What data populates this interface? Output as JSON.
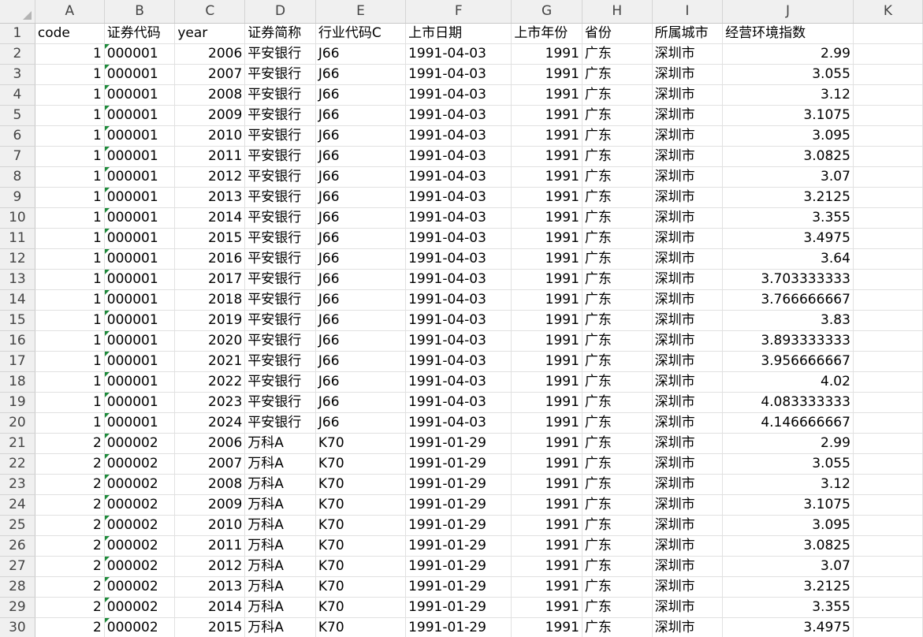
{
  "sheet": {
    "column_headers": [
      "A",
      "B",
      "C",
      "D",
      "E",
      "F",
      "G",
      "H",
      "I",
      "J",
      "K"
    ],
    "rows": [
      {
        "n": "1",
        "cells": [
          "code",
          "证券代码",
          "year",
          "证券简称",
          "行业代码C",
          "上市日期",
          "上市年份",
          "省份",
          "所属城市",
          "经营环境指数",
          ""
        ]
      },
      {
        "n": "2",
        "cells": [
          "1",
          "000001",
          "2006",
          "平安银行",
          "J66",
          "1991-04-03",
          "1991",
          "广东",
          "深圳市",
          "2.99",
          ""
        ]
      },
      {
        "n": "3",
        "cells": [
          "1",
          "000001",
          "2007",
          "平安银行",
          "J66",
          "1991-04-03",
          "1991",
          "广东",
          "深圳市",
          "3.055",
          ""
        ]
      },
      {
        "n": "4",
        "cells": [
          "1",
          "000001",
          "2008",
          "平安银行",
          "J66",
          "1991-04-03",
          "1991",
          "广东",
          "深圳市",
          "3.12",
          ""
        ]
      },
      {
        "n": "5",
        "cells": [
          "1",
          "000001",
          "2009",
          "平安银行",
          "J66",
          "1991-04-03",
          "1991",
          "广东",
          "深圳市",
          "3.1075",
          ""
        ]
      },
      {
        "n": "6",
        "cells": [
          "1",
          "000001",
          "2010",
          "平安银行",
          "J66",
          "1991-04-03",
          "1991",
          "广东",
          "深圳市",
          "3.095",
          ""
        ]
      },
      {
        "n": "7",
        "cells": [
          "1",
          "000001",
          "2011",
          "平安银行",
          "J66",
          "1991-04-03",
          "1991",
          "广东",
          "深圳市",
          "3.0825",
          ""
        ]
      },
      {
        "n": "8",
        "cells": [
          "1",
          "000001",
          "2012",
          "平安银行",
          "J66",
          "1991-04-03",
          "1991",
          "广东",
          "深圳市",
          "3.07",
          ""
        ]
      },
      {
        "n": "9",
        "cells": [
          "1",
          "000001",
          "2013",
          "平安银行",
          "J66",
          "1991-04-03",
          "1991",
          "广东",
          "深圳市",
          "3.2125",
          ""
        ]
      },
      {
        "n": "10",
        "cells": [
          "1",
          "000001",
          "2014",
          "平安银行",
          "J66",
          "1991-04-03",
          "1991",
          "广东",
          "深圳市",
          "3.355",
          ""
        ]
      },
      {
        "n": "11",
        "cells": [
          "1",
          "000001",
          "2015",
          "平安银行",
          "J66",
          "1991-04-03",
          "1991",
          "广东",
          "深圳市",
          "3.4975",
          ""
        ]
      },
      {
        "n": "12",
        "cells": [
          "1",
          "000001",
          "2016",
          "平安银行",
          "J66",
          "1991-04-03",
          "1991",
          "广东",
          "深圳市",
          "3.64",
          ""
        ]
      },
      {
        "n": "13",
        "cells": [
          "1",
          "000001",
          "2017",
          "平安银行",
          "J66",
          "1991-04-03",
          "1991",
          "广东",
          "深圳市",
          "3.703333333",
          ""
        ]
      },
      {
        "n": "14",
        "cells": [
          "1",
          "000001",
          "2018",
          "平安银行",
          "J66",
          "1991-04-03",
          "1991",
          "广东",
          "深圳市",
          "3.766666667",
          ""
        ]
      },
      {
        "n": "15",
        "cells": [
          "1",
          "000001",
          "2019",
          "平安银行",
          "J66",
          "1991-04-03",
          "1991",
          "广东",
          "深圳市",
          "3.83",
          ""
        ]
      },
      {
        "n": "16",
        "cells": [
          "1",
          "000001",
          "2020",
          "平安银行",
          "J66",
          "1991-04-03",
          "1991",
          "广东",
          "深圳市",
          "3.893333333",
          ""
        ]
      },
      {
        "n": "17",
        "cells": [
          "1",
          "000001",
          "2021",
          "平安银行",
          "J66",
          "1991-04-03",
          "1991",
          "广东",
          "深圳市",
          "3.956666667",
          ""
        ]
      },
      {
        "n": "18",
        "cells": [
          "1",
          "000001",
          "2022",
          "平安银行",
          "J66",
          "1991-04-03",
          "1991",
          "广东",
          "深圳市",
          "4.02",
          ""
        ]
      },
      {
        "n": "19",
        "cells": [
          "1",
          "000001",
          "2023",
          "平安银行",
          "J66",
          "1991-04-03",
          "1991",
          "广东",
          "深圳市",
          "4.083333333",
          ""
        ]
      },
      {
        "n": "20",
        "cells": [
          "1",
          "000001",
          "2024",
          "平安银行",
          "J66",
          "1991-04-03",
          "1991",
          "广东",
          "深圳市",
          "4.146666667",
          ""
        ]
      },
      {
        "n": "21",
        "cells": [
          "2",
          "000002",
          "2006",
          "万科A",
          "K70",
          "1991-01-29",
          "1991",
          "广东",
          "深圳市",
          "2.99",
          ""
        ]
      },
      {
        "n": "22",
        "cells": [
          "2",
          "000002",
          "2007",
          "万科A",
          "K70",
          "1991-01-29",
          "1991",
          "广东",
          "深圳市",
          "3.055",
          ""
        ]
      },
      {
        "n": "23",
        "cells": [
          "2",
          "000002",
          "2008",
          "万科A",
          "K70",
          "1991-01-29",
          "1991",
          "广东",
          "深圳市",
          "3.12",
          ""
        ]
      },
      {
        "n": "24",
        "cells": [
          "2",
          "000002",
          "2009",
          "万科A",
          "K70",
          "1991-01-29",
          "1991",
          "广东",
          "深圳市",
          "3.1075",
          ""
        ]
      },
      {
        "n": "25",
        "cells": [
          "2",
          "000002",
          "2010",
          "万科A",
          "K70",
          "1991-01-29",
          "1991",
          "广东",
          "深圳市",
          "3.095",
          ""
        ]
      },
      {
        "n": "26",
        "cells": [
          "2",
          "000002",
          "2011",
          "万科A",
          "K70",
          "1991-01-29",
          "1991",
          "广东",
          "深圳市",
          "3.0825",
          ""
        ]
      },
      {
        "n": "27",
        "cells": [
          "2",
          "000002",
          "2012",
          "万科A",
          "K70",
          "1991-01-29",
          "1991",
          "广东",
          "深圳市",
          "3.07",
          ""
        ]
      },
      {
        "n": "28",
        "cells": [
          "2",
          "000002",
          "2013",
          "万科A",
          "K70",
          "1991-01-29",
          "1991",
          "广东",
          "深圳市",
          "3.2125",
          ""
        ]
      },
      {
        "n": "29",
        "cells": [
          "2",
          "000002",
          "2014",
          "万科A",
          "K70",
          "1991-01-29",
          "1991",
          "广东",
          "深圳市",
          "3.355",
          ""
        ]
      },
      {
        "n": "30",
        "cells": [
          "2",
          "000002",
          "2015",
          "万科A",
          "K70",
          "1991-01-29",
          "1991",
          "广东",
          "深圳市",
          "3.4975",
          ""
        ]
      }
    ]
  }
}
